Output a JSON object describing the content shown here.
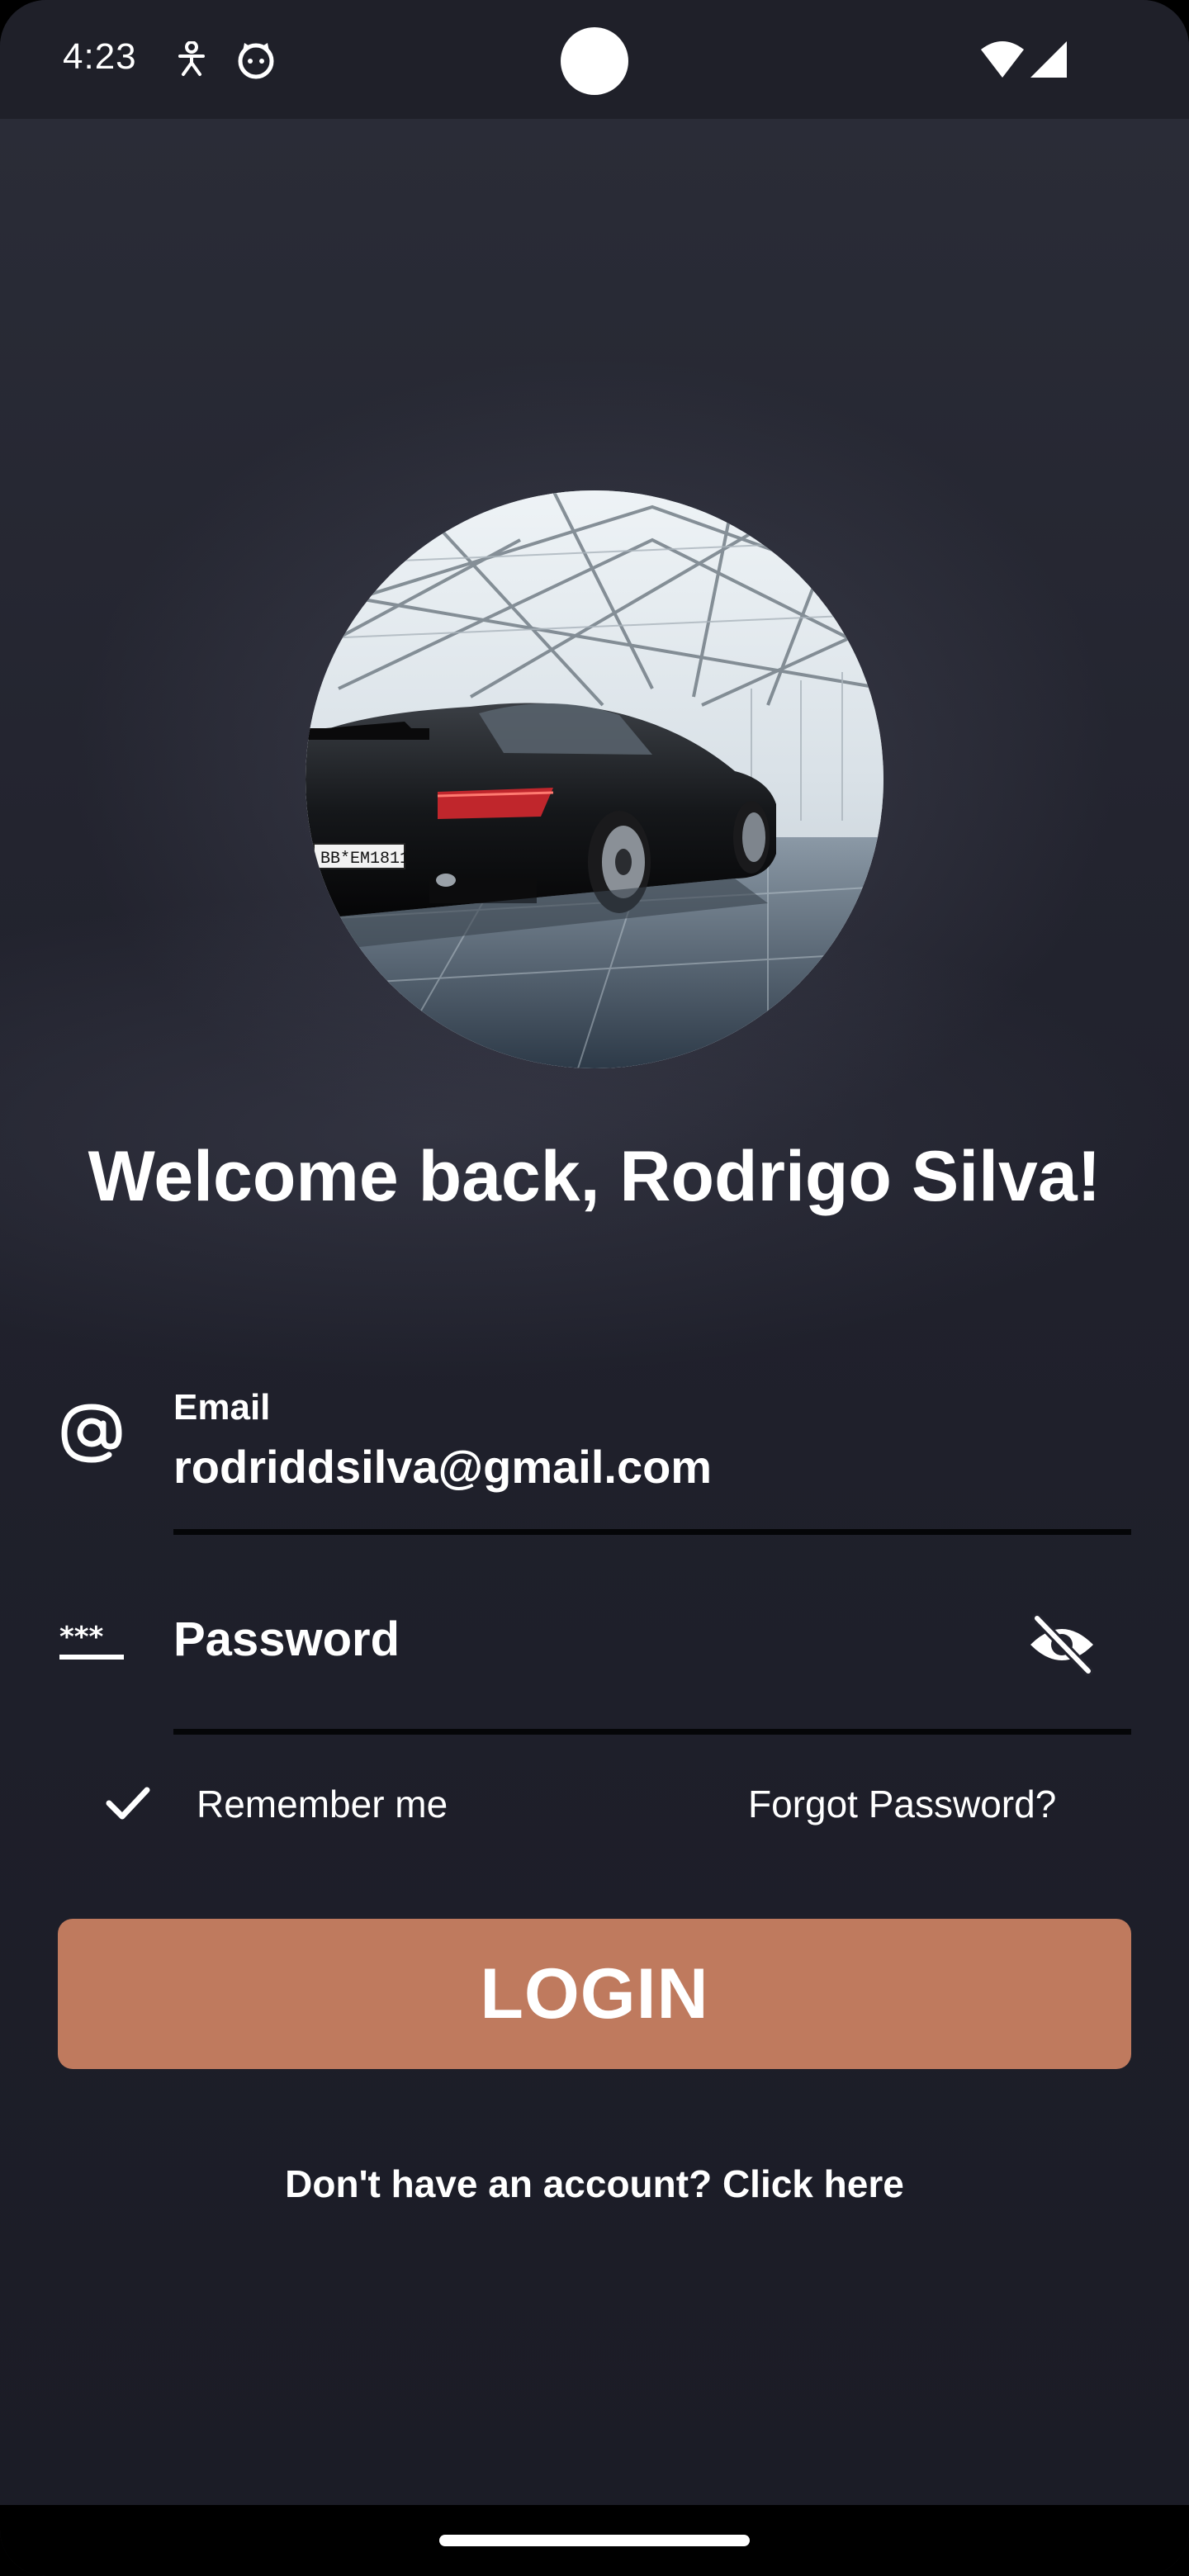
{
  "status_bar": {
    "time": "4:23",
    "icons": [
      "accessibility-icon",
      "cat-face-icon",
      "wifi-icon",
      "signal-icon"
    ]
  },
  "profile": {
    "avatar_description": "black-sports-car-photo"
  },
  "welcome": {
    "title": "Welcome back, Rodrigo Silva!"
  },
  "email": {
    "label": "Email",
    "value": "rodriddsilva@gmail.com",
    "icon": "at-sign-icon"
  },
  "password": {
    "placeholder": "Password",
    "icon": "password-dots-icon",
    "toggle_icon": "eye-off-icon"
  },
  "remember": {
    "label": "Remember me",
    "checked": true
  },
  "forgot": {
    "label": "Forgot Password?"
  },
  "login": {
    "label": "LOGIN",
    "color": "#bf7a5e"
  },
  "signup": {
    "label": "Don't have an account? Click here"
  },
  "colors": {
    "background": "#1d1e29",
    "accent": "#bf7a5e",
    "text": "#ffffff"
  }
}
